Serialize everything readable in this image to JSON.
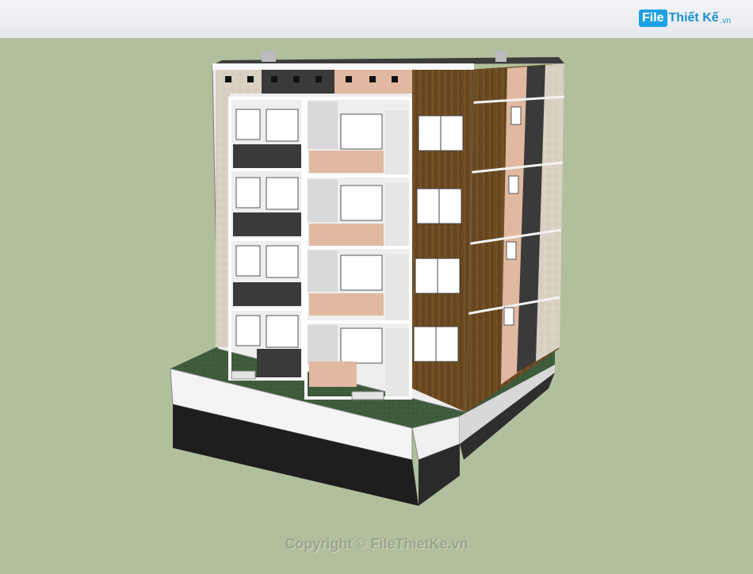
{
  "brand": {
    "badge": "File",
    "name": "Thiết Kế",
    "tld": ".vn"
  },
  "watermark": "Copyright © FileThietKe.vn",
  "colors": {
    "background": "#b2bf9c",
    "sky": "#eceef3",
    "wood": "#6b4a22",
    "peach": "#e0b9a0",
    "dark_panel": "#3a3a3a",
    "lawn": "#3d5a3a",
    "podium_white": "#f4f4f4",
    "podium_black": "#1e1e1e"
  }
}
